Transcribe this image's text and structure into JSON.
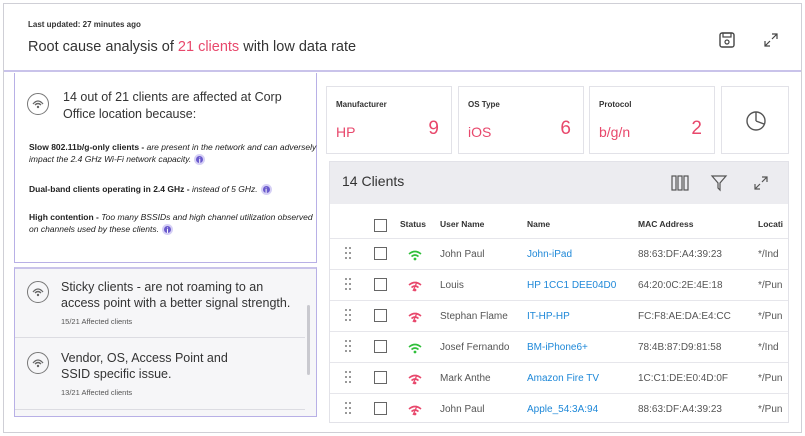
{
  "header": {
    "last_updated": "Last updated: 27 minutes ago",
    "title_prefix": "Root cause analysis of ",
    "title_highlight": "21 clients",
    "title_suffix": " with low data rate",
    "save_icon": "save-icon",
    "expand_icon": "expand-icon"
  },
  "analysis": {
    "summary": "14 out of 21 clients are affected at Corp Office location because:",
    "reasons": [
      {
        "bold": "Slow 802.11b/g-only clients -",
        "italic": " are present in the network and can adversely impact the 2.4 GHz Wi-Fi network capacity."
      },
      {
        "bold": "Dual-band clients operating in 2.4 GHz -",
        "italic": " instead of 5 GHz."
      },
      {
        "bold": "High contention -",
        "italic": " Too many BSSIDs and high channel utilization observed on channels used by these clients."
      }
    ]
  },
  "causes": [
    {
      "title": "Sticky clients - are not roaming to an access point with a better signal strength.",
      "sub": "15/21 Affected clients"
    },
    {
      "title": "Vendor, OS, Access Point and SSID specific issue.",
      "sub": "13/21 Affected clients"
    }
  ],
  "cards": [
    {
      "label": "Manufacturer",
      "value": "HP",
      "count": "9"
    },
    {
      "label": "OS Type",
      "value": "iOS",
      "count": "6"
    },
    {
      "label": "Protocol",
      "value": "b/g/n",
      "count": "2"
    }
  ],
  "clients": {
    "title": "14 Clients",
    "columns": [
      "Status",
      "User Name",
      "Name",
      "MAC Address",
      "Locati"
    ],
    "rows": [
      {
        "status": "good",
        "user": "John Paul",
        "name": "John-iPad",
        "mac": "88:63:DF:A4:39:23",
        "loc": "*/Ind"
      },
      {
        "status": "bad",
        "user": "Louis",
        "name": "HP 1CC1 DEE04D0",
        "mac": "64:20:0C:2E:4E:18",
        "loc": "*/Pun"
      },
      {
        "status": "bad",
        "user": "Stephan Flame",
        "name": "IT-HP-HP",
        "mac": "FC:F8:AE:DA:E4:CC",
        "loc": "*/Pun"
      },
      {
        "status": "good",
        "user": "Josef Fernando",
        "name": "BM-iPhone6+",
        "mac": "78:4B:87:D9:81:58",
        "loc": "*/Ind"
      },
      {
        "status": "bad",
        "user": "Mark Anthe",
        "name": "Amazon Fire TV",
        "mac": "1C:C1:DE:E0:4D:0F",
        "loc": "*/Pun"
      },
      {
        "status": "bad",
        "user": "John Paul",
        "name": "Apple_54:3A:94",
        "mac": "88:63:DF:A4:39:23",
        "loc": "*/Pun"
      }
    ]
  },
  "colors": {
    "accent": "#e8486c",
    "link": "#1e88d8",
    "good": "#2fbf3a",
    "bad": "#e8486c",
    "panel_border": "#b8b0e6"
  }
}
